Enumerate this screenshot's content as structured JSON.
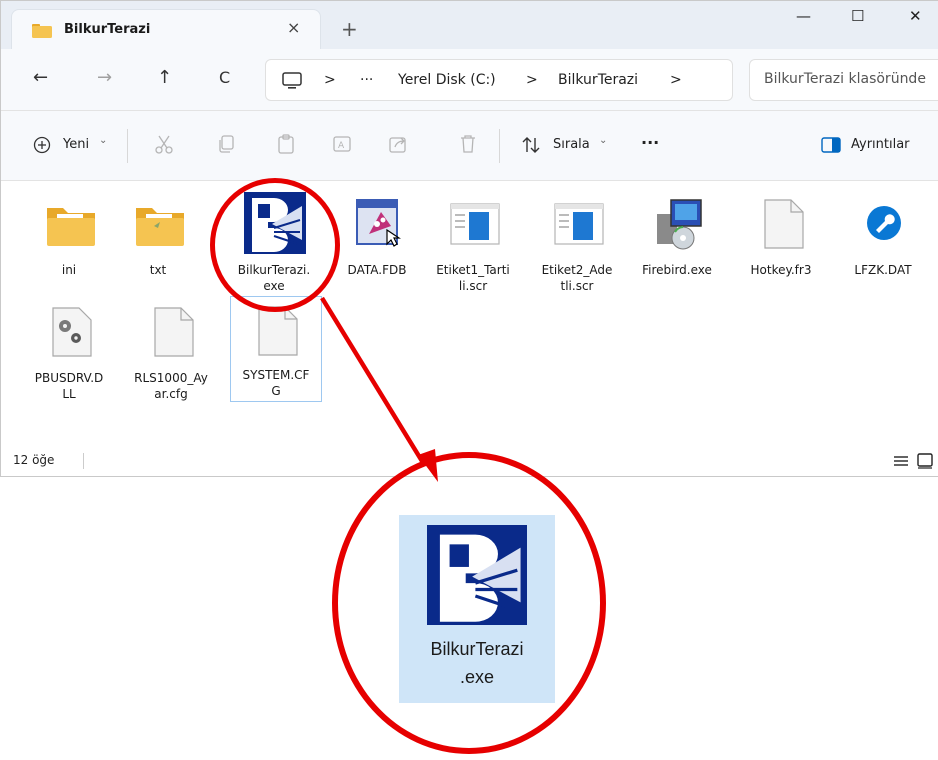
{
  "window": {
    "tab_title": "BilkurTerazi",
    "tab_close": "×",
    "new_tab": "+",
    "controls": {
      "minimize": "—",
      "maximize": "☐",
      "close": "✕"
    }
  },
  "address": {
    "back": "←",
    "forward": "→",
    "up": "↑",
    "refresh": "C",
    "more": "···",
    "breadcrumbs": [
      "Yerel Disk (C:)",
      "BilkurTerazi"
    ],
    "separator": ">",
    "search_placeholder": "BilkurTerazi klasöründe"
  },
  "toolbar": {
    "new_label": "Yeni",
    "sort_label": "Sırala",
    "more_label": "···",
    "details_label": "Ayrıntılar",
    "chevron": "⌄"
  },
  "files": [
    {
      "name": "ini",
      "icon": "folder-icon"
    },
    {
      "name": "txt",
      "icon": "folder-icon"
    },
    {
      "name": "BilkurTerazi.exe",
      "icon": "bilkur-app-icon"
    },
    {
      "name": "DATA.FDB",
      "icon": "firebird-db-icon"
    },
    {
      "name": "Etiket1_Tartili.scr",
      "icon": "screensaver-icon"
    },
    {
      "name": "Etiket2_Adetli.scr",
      "icon": "screensaver-icon"
    },
    {
      "name": "Firebird.exe",
      "icon": "installer-icon"
    },
    {
      "name": "Hotkey.fr3",
      "icon": "file-icon"
    },
    {
      "name": "LFZK.DAT",
      "icon": "settings-wrench-icon"
    },
    {
      "name": "PBUSDRV.DLL",
      "icon": "dll-gear-icon"
    },
    {
      "name": "RLS1000_Ayar.cfg",
      "icon": "file-icon"
    },
    {
      "name": "SYSTEM.CFG",
      "icon": "file-icon"
    }
  ],
  "file_name_lines": [
    [
      "ini"
    ],
    [
      "txt"
    ],
    [
      "BilkurTerazi.",
      "exe"
    ],
    [
      "DATA.FDB"
    ],
    [
      "Etiket1_Tarti",
      "li.scr"
    ],
    [
      "Etiket2_Ade",
      "tli.scr"
    ],
    [
      "Firebird.exe"
    ],
    [
      "Hotkey.fr3"
    ],
    [
      "LFZK.DAT"
    ],
    [
      "PBUSDRV.D",
      "LL"
    ],
    [
      "RLS1000_Ay",
      "ar.cfg"
    ],
    [
      "SYSTEM.CF",
      "G"
    ]
  ],
  "status": {
    "item_count": "12 öğe"
  },
  "zoom": {
    "name_line1": "BilkurTerazi",
    "name_line2": ".exe"
  },
  "colors": {
    "annotation": "#e60000",
    "selection": "#cfe5f8",
    "folder": "#f5c451",
    "app_blue": "#0a2a8a"
  }
}
